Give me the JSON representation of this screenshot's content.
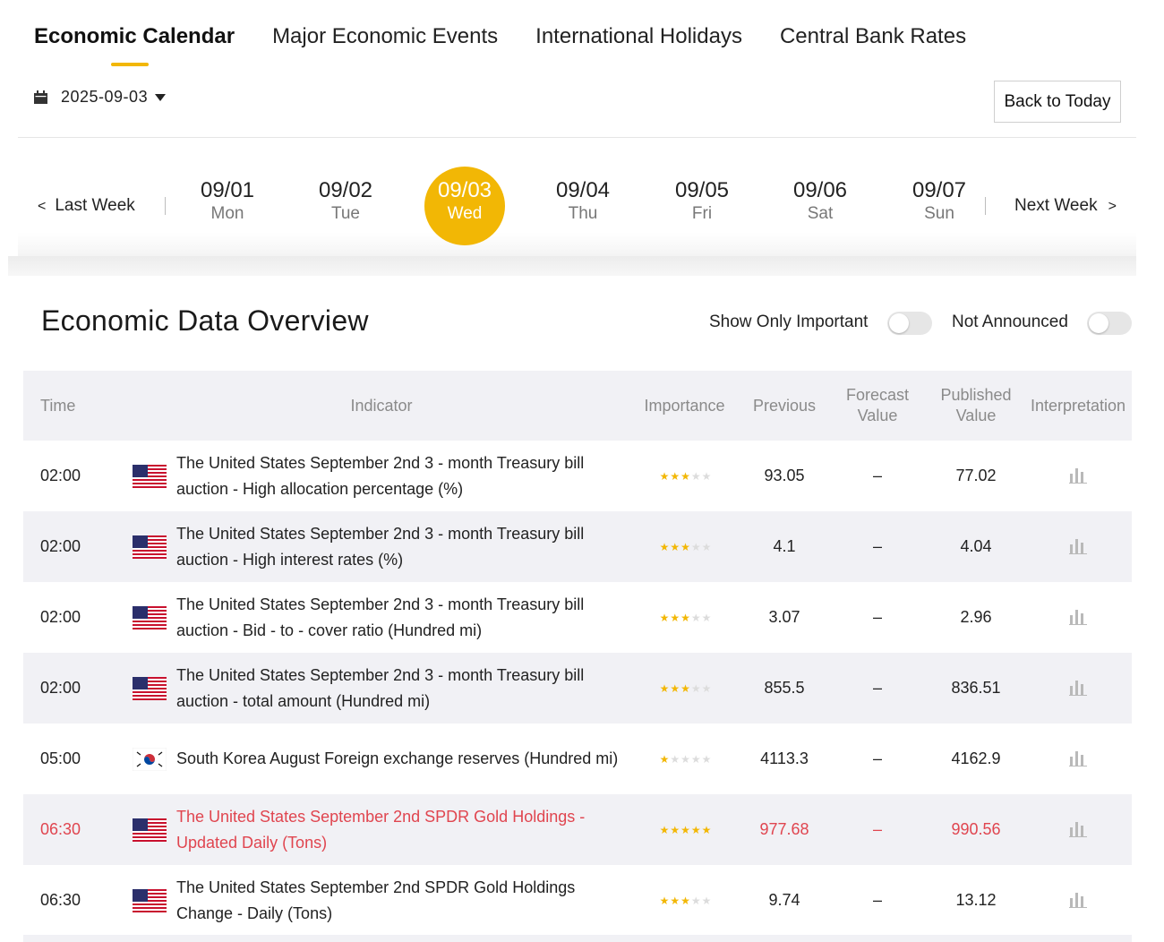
{
  "tabs": [
    {
      "label": "Economic Calendar",
      "active": true
    },
    {
      "label": "Major Economic Events",
      "active": false
    },
    {
      "label": "International Holidays",
      "active": false
    },
    {
      "label": "Central Bank Rates",
      "active": false
    }
  ],
  "date_picker": {
    "value": "2025-09-03",
    "icon": "calendar-icon"
  },
  "back_to_today": "Back to Today",
  "week_nav": {
    "last_week": "Last Week",
    "next_week": "Next Week",
    "last_arrow": "<",
    "next_arrow": ">",
    "days": [
      {
        "date": "09/01",
        "name": "Mon",
        "active": false
      },
      {
        "date": "09/02",
        "name": "Tue",
        "active": false
      },
      {
        "date": "09/03",
        "name": "Wed",
        "active": true
      },
      {
        "date": "09/04",
        "name": "Thu",
        "active": false
      },
      {
        "date": "09/05",
        "name": "Fri",
        "active": false
      },
      {
        "date": "09/06",
        "name": "Sat",
        "active": false
      },
      {
        "date": "09/07",
        "name": "Sun",
        "active": false
      }
    ]
  },
  "overview": {
    "title": "Economic Data Overview",
    "show_only_important": "Show Only Important",
    "not_announced": "Not Announced"
  },
  "table": {
    "headers": {
      "time": "Time",
      "indicator": "Indicator",
      "importance": "Importance",
      "previous": "Previous",
      "forecast": "Forecast Value",
      "published": "Published Value",
      "interpretation": "Interpretation"
    },
    "rows": [
      {
        "time": "02:00",
        "country": "us-flag",
        "indicator": "The United States September 2nd 3 - month Treasury bill auction - High allocation percentage (%)",
        "stars": 3,
        "previous": "93.05",
        "forecast": "–",
        "published": "77.02",
        "highlight": false
      },
      {
        "time": "02:00",
        "country": "us-flag",
        "indicator": "The United States September 2nd 3 - month Treasury bill auction - High interest rates (%)",
        "stars": 3,
        "previous": "4.1",
        "forecast": "–",
        "published": "4.04",
        "highlight": false
      },
      {
        "time": "02:00",
        "country": "us-flag",
        "indicator": "The United States September 2nd 3 - month Treasury bill auction - Bid - to - cover ratio (Hundred mi)",
        "stars": 3,
        "previous": "3.07",
        "forecast": "–",
        "published": "2.96",
        "highlight": false
      },
      {
        "time": "02:00",
        "country": "us-flag",
        "indicator": "The United States September 2nd 3 - month Treasury bill auction - total amount (Hundred mi)",
        "stars": 3,
        "previous": "855.5",
        "forecast": "–",
        "published": "836.51",
        "highlight": false
      },
      {
        "time": "05:00",
        "country": "kr-flag",
        "indicator": "South Korea August Foreign exchange reserves (Hundred mi)",
        "stars": 1,
        "previous": "4113.3",
        "forecast": "–",
        "published": "4162.9",
        "highlight": false
      },
      {
        "time": "06:30",
        "country": "us-flag",
        "indicator": "The United States September 2nd SPDR Gold Holdings - Updated Daily (Tons)",
        "stars": 5,
        "previous": "977.68",
        "forecast": "–",
        "published": "990.56",
        "highlight": true
      },
      {
        "time": "06:30",
        "country": "us-flag",
        "indicator": "The United States September 2nd SPDR Gold Holdings Change - Daily (Tons)",
        "stars": 3,
        "previous": "9.74",
        "forecast": "–",
        "published": "13.12",
        "highlight": false
      }
    ]
  },
  "colors": {
    "accent": "#f2b705",
    "highlight_text": "#e0454f",
    "row_alt": "#f1f1f5"
  }
}
